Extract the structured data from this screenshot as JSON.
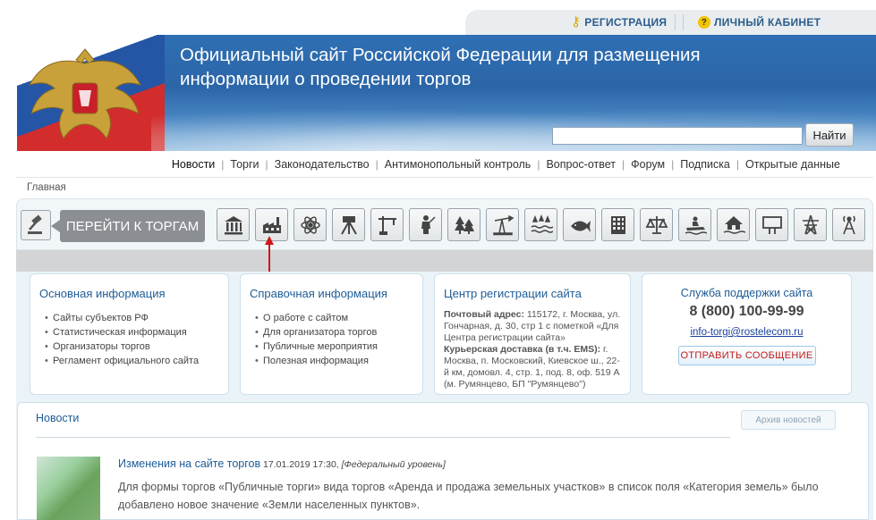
{
  "topbar": {
    "registration": "РЕГИСТРАЦИЯ",
    "cabinet": "ЛИЧНЫЙ КАБИНЕТ"
  },
  "banner": {
    "title": "Официальный сайт Российской Федерации для размещения информации о проведении торгов",
    "search_placeholder": "",
    "search_button": "Найти"
  },
  "nav": {
    "items": [
      "Новости",
      "Торги",
      "Законодательство",
      "Антимонопольный контроль",
      "Вопрос-ответ",
      "Форум",
      "Подписка",
      "Открытые данные"
    ]
  },
  "breadcrumb": "Главная",
  "iconbar": {
    "goto_label": "ПЕРЕЙТИ К ТОРГАМ",
    "sectors": [
      "bank-icon",
      "factory-icon",
      "atom-icon",
      "survey-tripod-icon",
      "crane-icon",
      "hunter-icon",
      "forest-icon",
      "oil-pump-icon",
      "water-rain-icon",
      "fish-icon",
      "building-icon",
      "scales-icon",
      "jetski-icon",
      "house-flood-icon",
      "billboard-icon",
      "power-tower-icon",
      "radio-tower-icon"
    ]
  },
  "info": {
    "main": {
      "title": "Основная информация",
      "items": [
        "Сайты субъектов РФ",
        "Статистическая информация",
        "Организаторы торгов",
        "Регламент официального сайта"
      ]
    },
    "reference": {
      "title": "Справочная информация",
      "items": [
        "О работе с сайтом",
        "Для организатора торгов",
        "Публичные мероприятия",
        "Полезная информация"
      ]
    },
    "registration": {
      "title": "Центр регистрации сайта",
      "postal_label": "Почтовый адрес:",
      "postal_text": " 115172, г. Москва, ул. Гончарная, д. 30, стр 1 с пометкой «Для Центра регистрации сайта»",
      "courier_label": "Курьерская доставка (в т.ч. EMS):",
      "courier_text": " г. Москва, п. Московский, Киевское ш., 22-й км, домовл. 4, стр. 1, под. 8, оф. 519 А (м. Румянцево, БП \"Румянцево\")"
    },
    "support": {
      "title": "Служба поддержки сайта",
      "phone": "8 (800) 100-99-99",
      "email": "info-torgi@rostelecom.ru",
      "send_button": "ОТПРАВИТЬ СООБЩЕНИЕ"
    }
  },
  "news": {
    "title": "Новости",
    "archive": "Архив новостей",
    "item": {
      "headline": "Изменения на сайте торгов",
      "date": " 17.01.2019 17:30, ",
      "level": "[Федеральный уровень]",
      "body": "Для формы торгов «Публичные торги» вида торгов «Аренда и продажа земельных участков» в список поля «Категория земель» было добавлено новое значение «Земли населенных пунктов»."
    }
  },
  "colors": {
    "link_blue": "#1e5c96",
    "send_red": "#c01b1b",
    "goto_grey": "#8b8f93"
  }
}
